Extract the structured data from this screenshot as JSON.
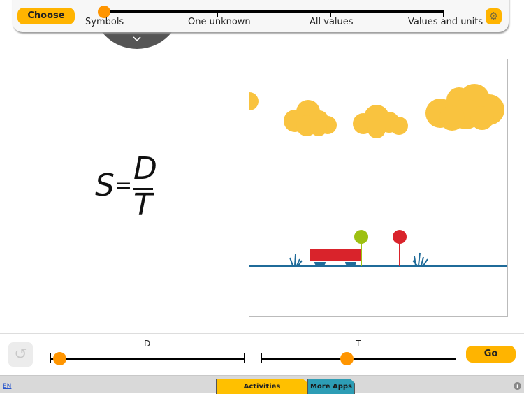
{
  "topbar": {
    "choose_label": "Choose",
    "levels": [
      "Symbols",
      "One unknown",
      "All values",
      "Values and units"
    ],
    "selected_level": "Symbols",
    "settings_icon": "gear-icon"
  },
  "pulltab": {
    "icon": "chevron-down-icon",
    "glyph": "⌵"
  },
  "formula": {
    "lhs": "S",
    "equals": "=",
    "numerator": "D",
    "denominator": "T"
  },
  "scene": {
    "colors": {
      "cloud": "#f9c33f",
      "car": "#d9232b",
      "wheel": "#1f6b99",
      "ground": "#1f6b99",
      "start_sign": "#9dc012",
      "end_sign": "#d9232b",
      "grass": "#1f6b99"
    }
  },
  "controls": {
    "reset_glyph": "↺",
    "sliders": [
      {
        "label": "D",
        "value_fraction": 0.05
      },
      {
        "label": "T",
        "value_fraction": 0.44
      }
    ],
    "go_label": "Go"
  },
  "footer": {
    "lang": "EN",
    "tabs": [
      "Activities",
      "More Apps"
    ],
    "info_glyph": "i"
  }
}
